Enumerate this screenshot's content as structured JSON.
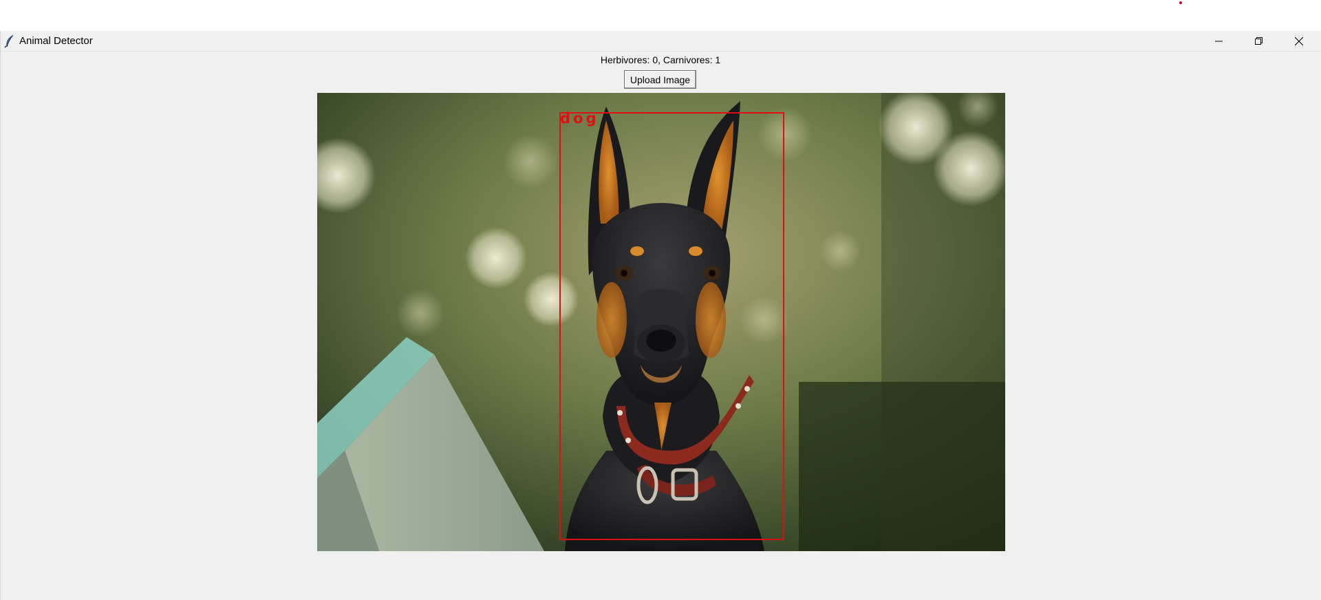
{
  "window": {
    "title": "Animal Detector",
    "app_icon": "feather-icon",
    "controls": [
      "minimize-icon",
      "restore-icon",
      "close-icon"
    ]
  },
  "status": {
    "text": "Herbivores: 0, Carnivores: 1"
  },
  "toolbar": {
    "upload_label": "Upload Image"
  },
  "detection": {
    "label": "dog",
    "box_color": "#e01010"
  },
  "colors": {
    "window_bg": "#f0f0f0",
    "accent_red": "#e01010"
  }
}
